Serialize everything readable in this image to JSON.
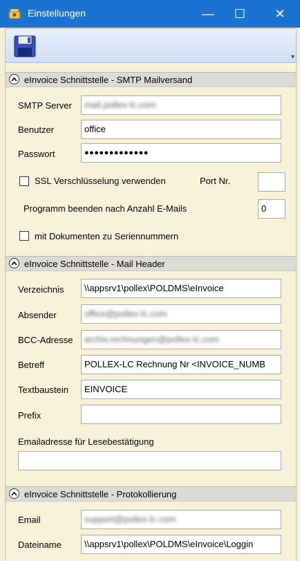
{
  "window": {
    "title": "Einstellungen",
    "minimize": "—",
    "maximize": "☐",
    "close": "✕"
  },
  "toolbar": {
    "overflow": "▾"
  },
  "smtp": {
    "header": "eInvoice Schnittstelle - SMTP Mailversand",
    "server_label": "SMTP Server",
    "server_value": "mail.pollex-lc.com",
    "user_label": "Benutzer",
    "user_value": "office",
    "password_label": "Passwort",
    "password_value": "●●●●●●●●●●●●●",
    "ssl_label": "SSL Verschlüsselung verwenden",
    "port_label": "Port Nr.",
    "port_value": "",
    "quit_label": "Programm beenden nach Anzahl E-Mails",
    "quit_value": "0",
    "docs_label": "mit Dokumenten zu Seriennummern"
  },
  "mail_header": {
    "header": "eInvoice Schnittstelle - Mail Header",
    "dir_label": "Verzeichnis",
    "dir_value": "\\\\appsrv1\\pollex\\POLDMS\\eInvoice",
    "sender_label": "Absender",
    "sender_value": "office@pollex-lc.com",
    "bcc_label": "BCC-Adresse",
    "bcc_value": "archiv.rechnungen@pollex-lc.com",
    "subject_label": "Betreff",
    "subject_value": "POLLEX-LC Rechnung Nr <INVOICE_NUMB",
    "text_label": "Textbaustein",
    "text_value": "EINVOICE",
    "prefix_label": "Prefix",
    "prefix_value": "",
    "receipt_label": "Emailadresse für Lesebestätigung",
    "receipt_value": ""
  },
  "logging": {
    "header": "eInvoice Schnittstelle - Protokollierung",
    "email_label": "Email",
    "email_value": "support@pollex-lc.com",
    "file_label": "Dateiname",
    "file_value": "\\\\appsrv1\\pollex\\POLDMS\\eInvoice\\Loggin"
  }
}
